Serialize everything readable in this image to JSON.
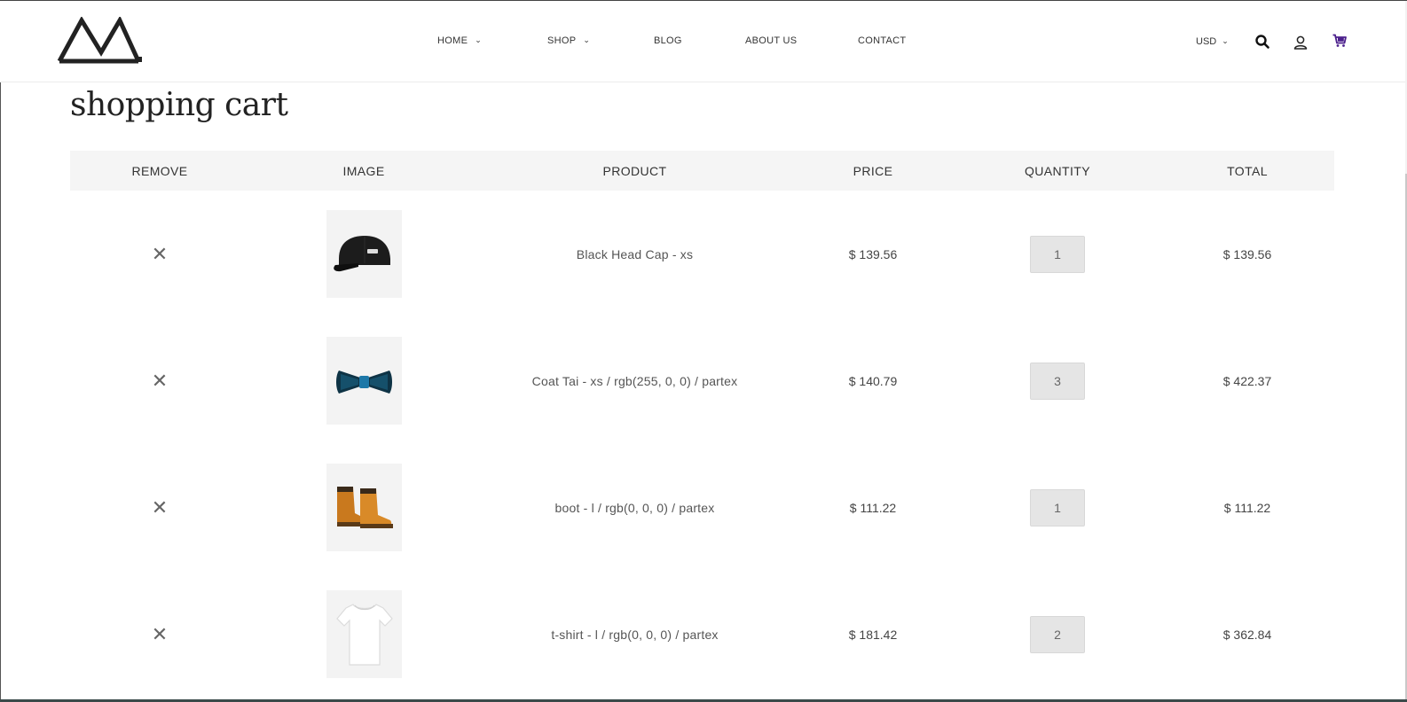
{
  "brand": {
    "logo_icon": "mountain-logo-icon"
  },
  "nav": {
    "items": [
      {
        "label": "HOME",
        "has_dropdown": true
      },
      {
        "label": "SHOP",
        "has_dropdown": true
      },
      {
        "label": "BLOG",
        "has_dropdown": false
      },
      {
        "label": "ABOUT US",
        "has_dropdown": false
      },
      {
        "label": "CONTACT",
        "has_dropdown": false
      }
    ],
    "caret": "⌄"
  },
  "header_tools": {
    "currency": "USD",
    "icons": [
      "search-icon",
      "user-icon",
      "cart-icon"
    ],
    "cart_icon_color": "#4b1f8c"
  },
  "page": {
    "title": "shopping cart"
  },
  "cart": {
    "columns": [
      "REMOVE",
      "IMAGE",
      "PRODUCT",
      "PRICE",
      "QUANTITY",
      "TOTAL"
    ],
    "remove_glyph": "✕",
    "items": [
      {
        "image_icon": "black-cap-icon",
        "product": "Black Head Cap  - xs",
        "price": "$ 139.56",
        "quantity": "1",
        "total": "$ 139.56"
      },
      {
        "image_icon": "bow-tie-icon",
        "product": "Coat Tai  - xs  / rgb(255, 0, 0)  / partex",
        "price": "$ 140.79",
        "quantity": "3",
        "total": "$ 422.37"
      },
      {
        "image_icon": "boots-icon",
        "product": "boot  - l  / rgb(0, 0, 0)  / partex",
        "price": "$ 111.22",
        "quantity": "1",
        "total": "$ 111.22"
      },
      {
        "image_icon": "tshirt-icon",
        "product": "t-shirt  - l  / rgb(0, 0, 0)  / partex",
        "price": "$ 181.42",
        "quantity": "2",
        "total": "$ 362.84"
      }
    ]
  }
}
